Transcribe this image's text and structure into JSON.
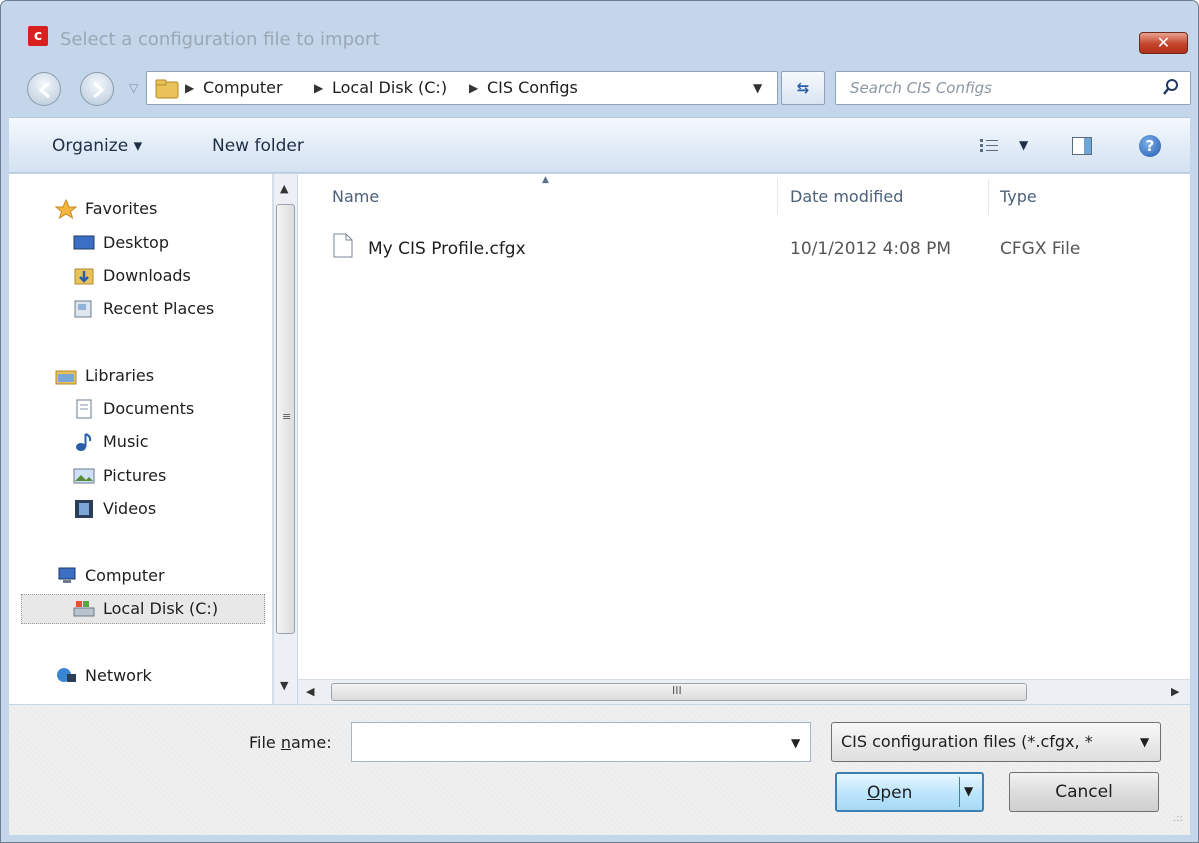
{
  "window": {
    "title": "Select a configuration file to import",
    "close_label": "✕"
  },
  "address": {
    "crumbs": [
      "Computer",
      "Local Disk (C:)",
      "CIS Configs"
    ]
  },
  "search": {
    "placeholder": "Search CIS Configs"
  },
  "toolbar": {
    "organize_label": "Organize ▾",
    "new_folder_label": "New folder"
  },
  "nav": {
    "favorites": "Favorites",
    "desktop": "Desktop",
    "downloads": "Downloads",
    "recent_places": "Recent Places",
    "libraries": "Libraries",
    "documents": "Documents",
    "music": "Music",
    "pictures": "Pictures",
    "videos": "Videos",
    "computer": "Computer",
    "local_disk": "Local Disk (C:)",
    "network": "Network"
  },
  "columns": {
    "name": "Name",
    "date_modified": "Date modified",
    "type": "Type"
  },
  "files": [
    {
      "name": "My CIS Profile.cfgx",
      "date_modified": "10/1/2012 4:08 PM",
      "type": "CFGX File"
    }
  ],
  "hscroll_grip": "III",
  "bottom": {
    "file_name_label_pre": "File ",
    "file_name_label_underlined": "n",
    "file_name_label_post": "ame:",
    "file_name_value": "",
    "filter_value": "CIS configuration files (*.cfgx, *",
    "open_label_underlined": "O",
    "open_label_rest": "pen",
    "cancel_label": "Cancel"
  },
  "colors": {
    "frame": "#c4d7ea",
    "toolbar": "#dfeaf6",
    "open_button_border": "#3c7fb1",
    "close_button": "#c2452b"
  },
  "icons": [
    "app-icon",
    "back-arrow-icon",
    "forward-arrow-icon",
    "folder-icon",
    "refresh-icon",
    "search-icon",
    "views-icon",
    "preview-pane-icon",
    "help-icon",
    "star-icon",
    "desktop-icon",
    "downloads-icon",
    "recent-places-icon",
    "libraries-icon",
    "documents-icon",
    "music-icon",
    "pictures-icon",
    "videos-icon",
    "computer-icon",
    "local-disk-icon",
    "network-icon",
    "file-icon"
  ]
}
